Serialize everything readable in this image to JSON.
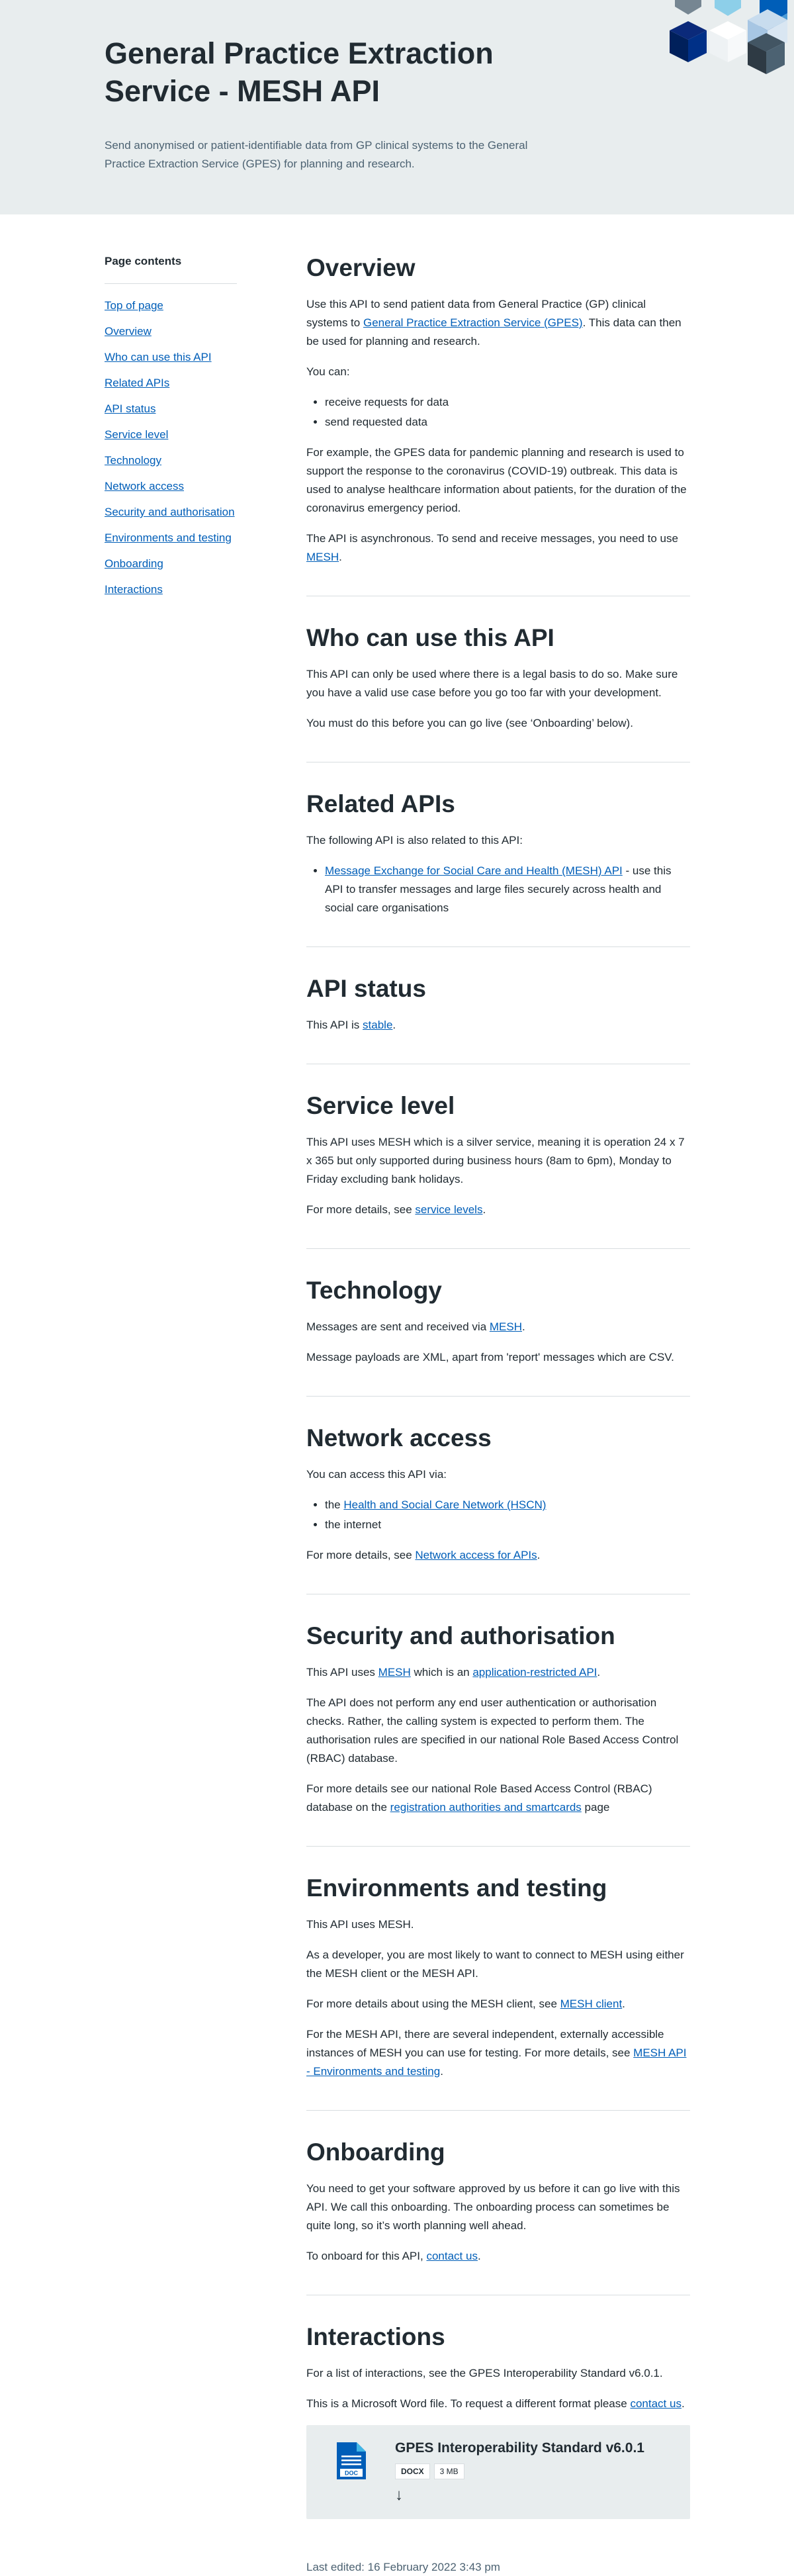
{
  "hero": {
    "title": "General Practice Extraction Service - MESH API",
    "description": "Send anonymised or patient-identifiable data from GP clinical systems to the General Practice Extraction Service (GPES) for planning and research."
  },
  "sidebar": {
    "heading": "Page contents",
    "items": [
      {
        "label": "Top of page"
      },
      {
        "label": "Overview"
      },
      {
        "label": "Who can use this API"
      },
      {
        "label": "Related APIs"
      },
      {
        "label": "API status"
      },
      {
        "label": "Service level"
      },
      {
        "label": "Technology"
      },
      {
        "label": "Network access"
      },
      {
        "label": "Security and authorisation"
      },
      {
        "label": "Environments and testing"
      },
      {
        "label": "Onboarding"
      },
      {
        "label": "Interactions"
      }
    ]
  },
  "overview": {
    "heading": "Overview",
    "p1_a": "Use this API to send patient data from General Practice (GP) clinical systems to ",
    "p1_link": "General Practice Extraction Service (GPES)",
    "p1_b": ". This data can then be used for planning and research.",
    "p2": "You can:",
    "bullets": [
      "receive requests for data",
      "send requested data"
    ],
    "p3": "For example, the GPES data for pandemic planning and research is used to support the response to the coronavirus (COVID-19) outbreak. This data is used to analyse healthcare information about patients, for the duration of the coronavirus emergency period.",
    "p4_a": "The API is asynchronous. To send and receive messages, you need to use ",
    "p4_link": "MESH",
    "p4_b": "."
  },
  "who": {
    "heading": "Who can use this API",
    "p1": "This API can only be used where there is a legal basis to do so. Make sure you have a valid use case before you go too far with your development.",
    "p2": "You must do this before you can go live (see ‘Onboarding’ below)."
  },
  "related": {
    "heading": "Related APIs",
    "p1": "The following API is also related to this API:",
    "item_link": "Message Exchange for Social Care and Health (MESH) API",
    "item_text": " - use this API to transfer messages and large files securely across health and social care organisations"
  },
  "status": {
    "heading": "API status",
    "p1_a": "This API is ",
    "p1_link": "stable",
    "p1_b": "."
  },
  "service": {
    "heading": "Service level",
    "p1": "This API uses MESH which is a silver service, meaning it is operation 24 x 7 x 365 but only supported during business hours (8am to 6pm), Monday to Friday excluding bank holidays.",
    "p2_a": "For more details, see ",
    "p2_link": "service levels",
    "p2_b": "."
  },
  "technology": {
    "heading": "Technology",
    "p1_a": "Messages are sent and received via ",
    "p1_link": "MESH",
    "p1_b": ".",
    "p2": "Message payloads are XML, apart from 'report' messages which are CSV."
  },
  "network": {
    "heading": "Network access",
    "p1": "You can access this API via:",
    "b1_a": "the ",
    "b1_link": "Health and Social Care Network (HSCN)",
    "b2": "the internet",
    "p2_a": "For more details, see ",
    "p2_link": "Network access for APIs",
    "p2_b": "."
  },
  "security": {
    "heading": "Security and authorisation",
    "p1_a": "This API uses ",
    "p1_link1": "MESH",
    "p1_b": " which is an ",
    "p1_link2": "application-restricted API",
    "p1_c": ".",
    "p2": "The API does not perform any end user authentication or authorisation checks. Rather, the calling system is expected to perform them. The authorisation rules are specified in our national Role Based Access Control (RBAC) database.",
    "p3_a": "For more details see our national Role Based Access Control (RBAC) database on the ",
    "p3_link": "registration authorities and smartcards",
    "p3_b": " page"
  },
  "environments": {
    "heading": "Environments and testing",
    "p1": "This API uses MESH.",
    "p2": "As a developer, you are most likely to want to connect to MESH using either the MESH client or the MESH API.",
    "p3_a": "For more details about using the MESH client, see ",
    "p3_link": "MESH client",
    "p3_b": ".",
    "p4_a": "For the MESH API, there are several independent, externally accessible instances of MESH you can use for testing. For more details, see ",
    "p4_link": "MESH API - Environments and testing",
    "p4_b": "."
  },
  "onboarding": {
    "heading": "Onboarding",
    "p1": "You need to get your software approved by us before it can go live with this API. We call this onboarding. The onboarding process can sometimes be quite long, so it’s worth planning well ahead.",
    "p2_a": "To onboard for this API, ",
    "p2_link": "contact us",
    "p2_b": "."
  },
  "interactions": {
    "heading": "Interactions",
    "p1": "For a list of interactions, see the GPES Interoperability Standard v6.0.1.",
    "p2_a": "This is a Microsoft Word file.  To request a different format please ",
    "p2_link": "contact us",
    "p2_b": ".",
    "download": {
      "title": "GPES Interoperability Standard v6.0.1",
      "file_type": "DOCX",
      "file_size": "3 MB",
      "icon_text": "DOC",
      "download_icon": "arrow-down-icon"
    }
  },
  "footer": {
    "last_edited": "Last edited: 16 February 2022 3:43 pm"
  },
  "colors": {
    "link": "#005eb8",
    "text": "#212b32",
    "hero_bg": "#e8edee",
    "nhs_blue": "#005eb8",
    "dark_blue": "#003087"
  }
}
